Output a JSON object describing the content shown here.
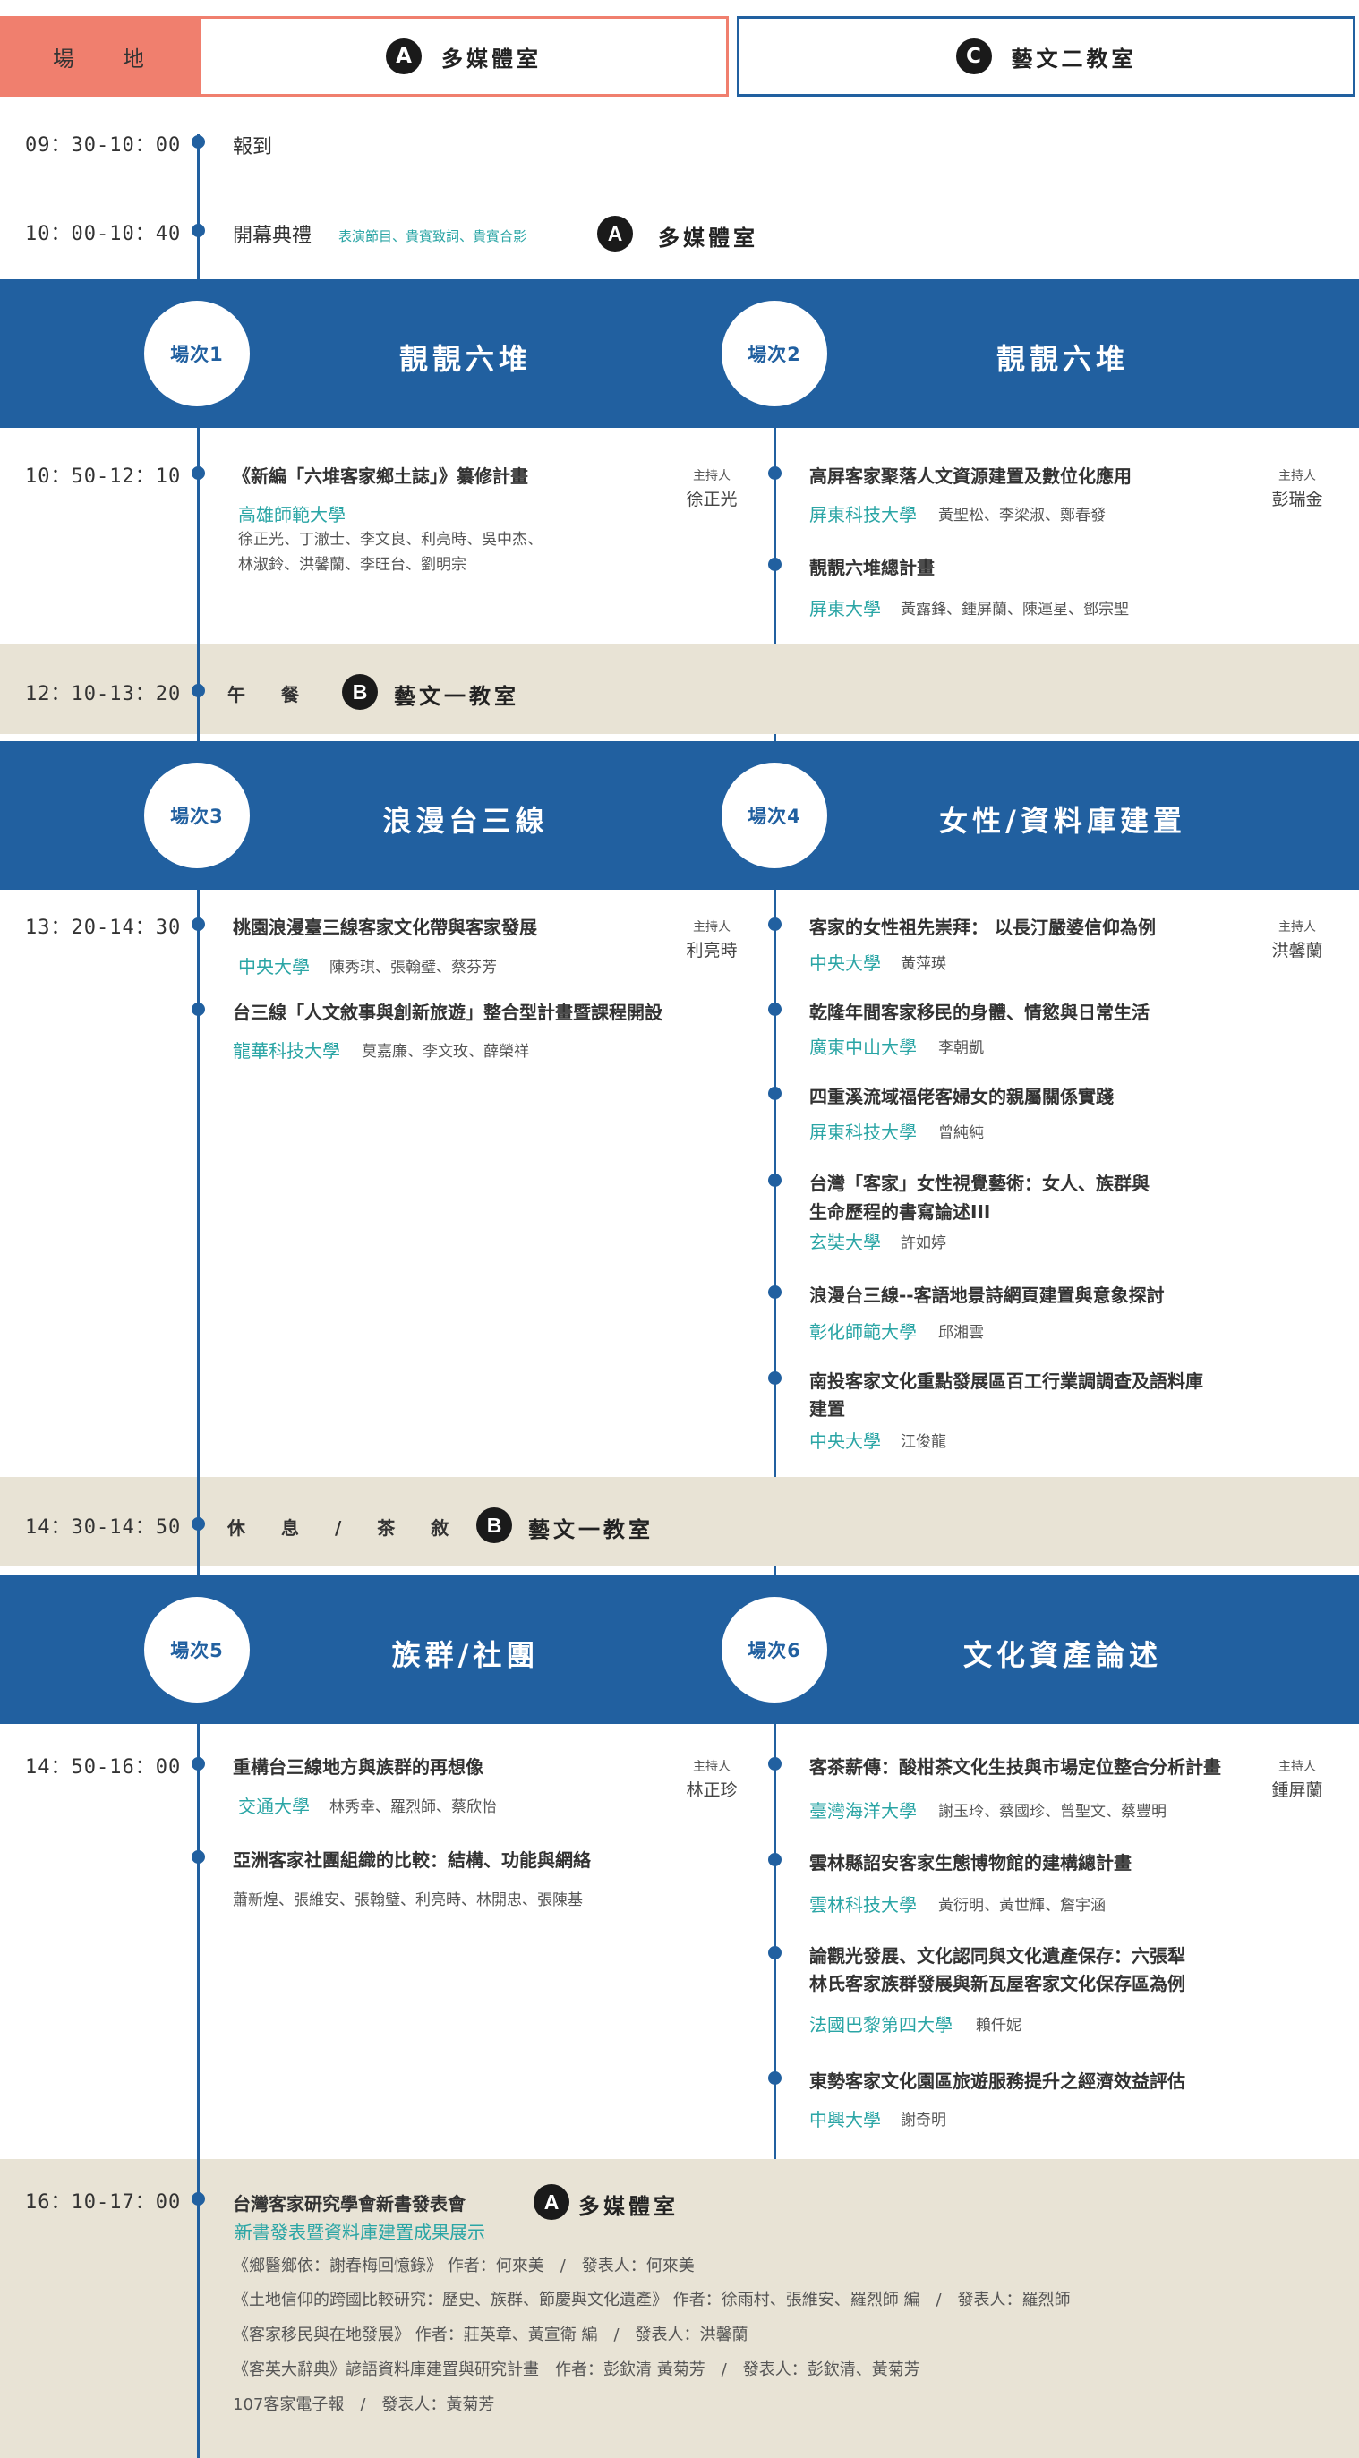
{
  "header": {
    "venue_label": "場　　地",
    "room_a_badge": "A",
    "room_a_name": "多媒體室",
    "room_c_badge": "C",
    "room_c_name": "藝文二教室"
  },
  "schedule": {
    "registration": {
      "time": "09：30-10：00",
      "label": "報到"
    },
    "opening": {
      "time": "10：00-10：40",
      "label": "開幕典禮",
      "sub": "表演節目、貴賓致詞、貴賓合影",
      "badge": "A",
      "room": "多媒體室"
    },
    "lunch": {
      "time": "12：10-13：20",
      "label": "午　　餐",
      "badge": "B",
      "room": "藝文一教室"
    },
    "break": {
      "time": "14：30-14：50",
      "label": "休　　息　　/　　茶　　敘",
      "badge": "B",
      "room": "藝文一教室"
    }
  },
  "sessions": {
    "s1": {
      "circle": "場次1",
      "title": "靚靚六堆"
    },
    "s2": {
      "circle": "場次2",
      "title": "靚靚六堆"
    },
    "s3": {
      "circle": "場次3",
      "title": "浪漫台三線"
    },
    "s4": {
      "circle": "場次4",
      "title": "女性/資料庫建置"
    },
    "s5": {
      "circle": "場次5",
      "title": "族群/社團"
    },
    "s6": {
      "circle": "場次6",
      "title": "文化資產論述"
    }
  },
  "block1": {
    "time": "10：50-12：10",
    "host_label": "主持人",
    "left_host": "徐正光",
    "right_host": "彭瑞金",
    "left": [
      {
        "title": "《新編「六堆客家鄉土誌」》纂修計畫",
        "uni": "高雄師範大學",
        "people1": "徐正光、丁澈士、李文良、利亮時、吳中杰、",
        "people2": "林淑鈴、洪馨蘭、李旺台、劉明宗"
      }
    ],
    "right": [
      {
        "title": "高屏客家聚落人文資源建置及數位化應用",
        "uni": "屏東科技大學",
        "people": "黃聖松、李梁淑、鄭春發"
      },
      {
        "title": "靚靚六堆總計畫",
        "uni": "屏東大學",
        "people": "黃露鋒、鍾屏蘭、陳運星、鄧宗聖"
      }
    ]
  },
  "block2": {
    "time": "13：20-14：30",
    "host_label": "主持人",
    "left_host": "利亮時",
    "right_host": "洪馨蘭",
    "left": [
      {
        "title": "桃園浪漫臺三線客家文化帶與客家發展",
        "uni": "中央大學",
        "people": "陳秀琪、張翰璧、蔡芬芳"
      },
      {
        "title": "台三線「人文敘事與創新旅遊」整合型計畫暨課程開設",
        "uni": "龍華科技大學",
        "people": "莫嘉廉、李文玫、薛榮祥"
      }
    ],
    "right": [
      {
        "title": "客家的女性祖先崇拜： 以長汀嚴婆信仰為例",
        "uni": "中央大學",
        "people": "黃萍瑛"
      },
      {
        "title": "乾隆年間客家移民的身體、情慾與日常生活",
        "uni": "廣東中山大學",
        "people": "李朝凱"
      },
      {
        "title": "四重溪流域福佬客婦女的親屬關係實踐",
        "uni": "屏東科技大學",
        "people": "曾純純"
      },
      {
        "title": "台灣「客家」女性視覺藝術：女人、族群與",
        "title2": "生命歷程的書寫論述III",
        "uni": "玄奘大學",
        "people": "許如婷"
      },
      {
        "title": "浪漫台三線--客語地景詩網頁建置與意象探討",
        "uni": "彰化師範大學",
        "people": "邱湘雲"
      },
      {
        "title": "南投客家文化重點發展區百工行業調調查及語料庫",
        "title2": "建置",
        "uni": "中央大學",
        "people": "江俊龍"
      }
    ]
  },
  "block3": {
    "time": "14：50-16：00",
    "host_label": "主持人",
    "left_host": "林正珍",
    "right_host": "鍾屏蘭",
    "left": [
      {
        "title": "重構台三線地方與族群的再想像",
        "uni": "交通大學",
        "people": "林秀幸、羅烈師、蔡欣怡"
      },
      {
        "title": "亞洲客家社團組織的比較：結構、功能與網絡",
        "people": "蕭新煌、張維安、張翰璧、利亮時、林開忠、張陳基"
      }
    ],
    "right": [
      {
        "title": "客茶薪傳：酸柑茶文化生技與市場定位整合分析計畫",
        "uni": "臺灣海洋大學",
        "people": "謝玉玲、蔡國珍、曾聖文、蔡豐明"
      },
      {
        "title": "雲林縣詔安客家生態博物館的建構總計畫",
        "uni": "雲林科技大學",
        "people": "黃衍明、黃世輝、詹宇涵"
      },
      {
        "title": "論觀光發展、文化認同與文化遺產保存：六張犁",
        "title2": "林氏客家族群發展與新瓦屋客家文化保存區為例",
        "uni": "法國巴黎第四大學",
        "people": "賴仟妮"
      },
      {
        "title": "東勢客家文化園區旅遊服務提升之經濟效益評估",
        "uni": "中興大學",
        "people": "謝奇明"
      }
    ]
  },
  "launch": {
    "time": "16：10-17：00",
    "title": "台灣客家研究學會新書發表會",
    "badge": "A",
    "room": "多媒體室",
    "subtitle": "新書發表暨資料庫建置成果展示",
    "items": [
      "《鄉醫鄉依：謝春梅回憶錄》 作者：何來美　/　發表人：何來美",
      "《土地信仰的跨國比較研究：歷史、族群、節慶與文化遺產》 作者：徐雨村、張維安、羅烈師 編　/　發表人：羅烈師",
      "《客家移民與在地發展》 作者：莊英章、黃宣衛 編　/　發表人：洪馨蘭",
      "《客英大辭典》諺語資料庫建置與研究計畫　作者：彭欽清 黃菊芳　/　發表人：彭欽清、黃菊芳",
      "107客家電子報　/　發表人：黃菊芳"
    ]
  },
  "colors": {
    "blue": "#2160a0",
    "teal": "#2aa5a5",
    "salmon": "#f07f6e",
    "beige": "#e8e3d5"
  }
}
